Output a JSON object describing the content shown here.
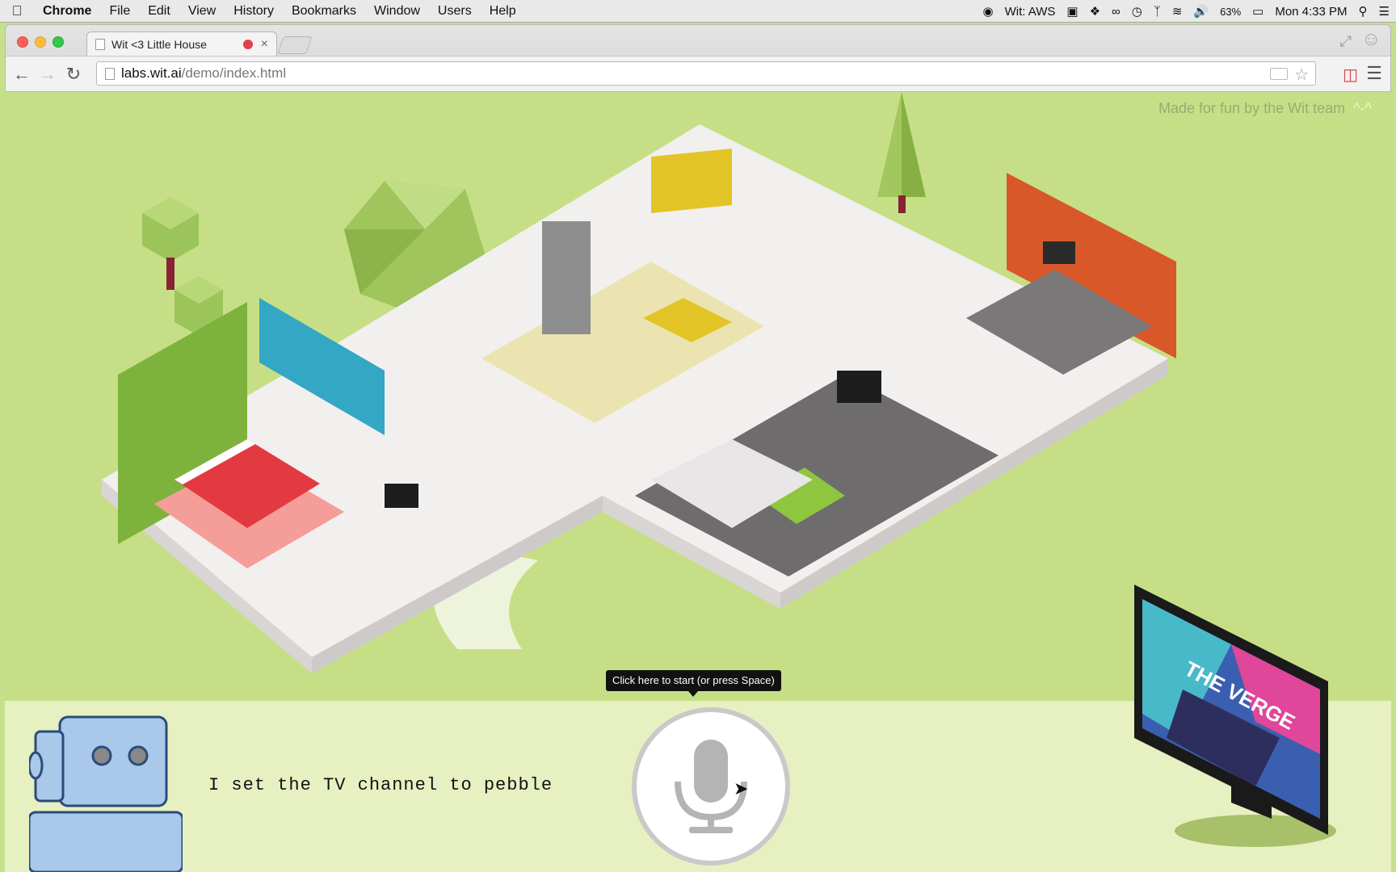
{
  "menubar": {
    "app_name": "Chrome",
    "items": [
      "File",
      "Edit",
      "View",
      "History",
      "Bookmarks",
      "Window",
      "Users",
      "Help"
    ],
    "status": {
      "wit_label": "Wit: AWS",
      "battery": "63%",
      "clock": "Mon 4:33 PM"
    }
  },
  "browser": {
    "tab_title": "Wit <3 Little House",
    "url_host": "labs.wit.ai",
    "url_path": "/demo/index.html"
  },
  "page": {
    "credit": "Made for fun by the Wit team",
    "credit_face": "^-^",
    "tooltip": "Click here to start (or press Space)",
    "transcript": "I set the TV channel to pebble",
    "tv_brand": "THE VERGE"
  },
  "colors": {
    "lawn": "#c6df86",
    "panel": "#e7f0c1",
    "bedroom_wall": "#7db33c",
    "bathroom_wall": "#33a7c4",
    "office_wall": "#d8582a",
    "bed": "#e23a40",
    "kitchen_cabinet": "#e2c427",
    "robot": "#a9c8ea"
  }
}
